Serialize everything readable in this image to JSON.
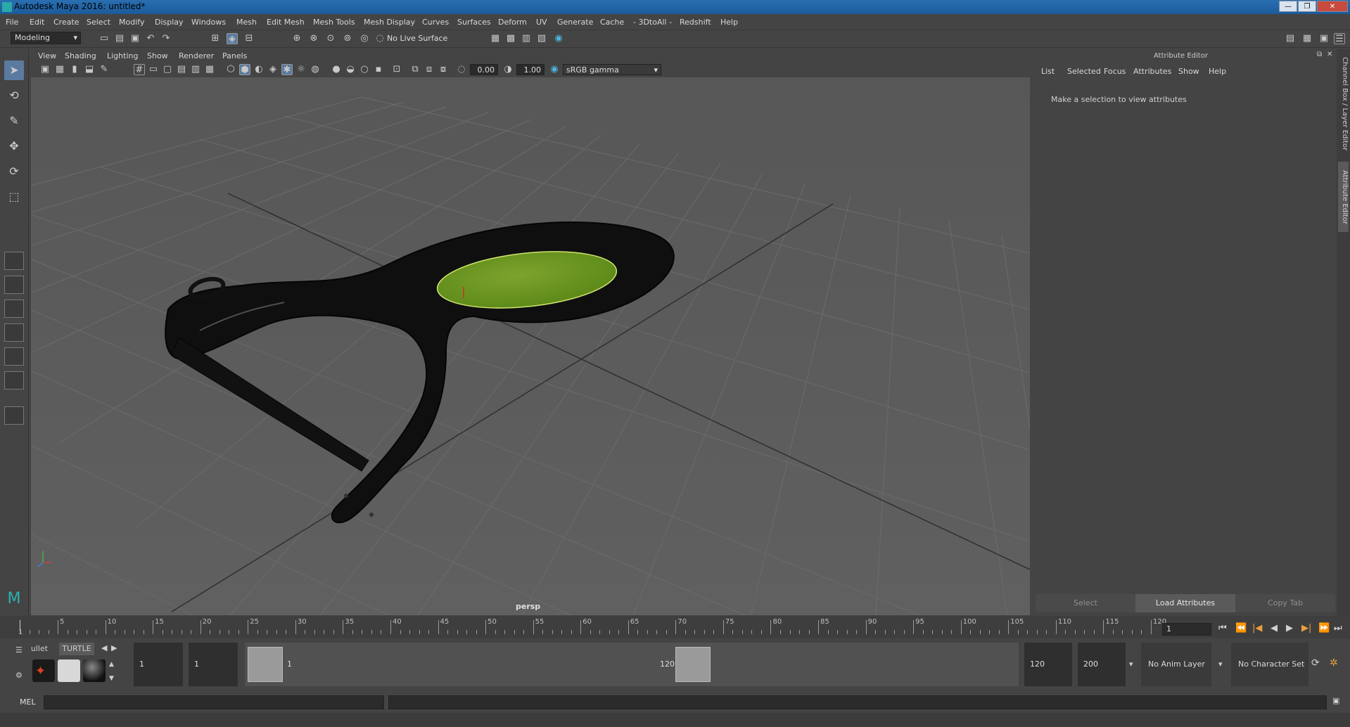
{
  "window": {
    "title": "Autodesk Maya 2016: untitled*"
  },
  "menu": [
    "File",
    "Edit",
    "Create",
    "Select",
    "Modify",
    "Display",
    "Windows",
    "Mesh",
    "Edit Mesh",
    "Mesh Tools",
    "Mesh Display",
    "Curves",
    "Surfaces",
    "Deform",
    "UV",
    "Generate",
    "Cache",
    "- 3DtoAll -",
    "Redshift",
    "Help"
  ],
  "status": {
    "mode": "Modeling",
    "live_surface": "No Live Surface"
  },
  "panel": {
    "menu": [
      "View",
      "Shading",
      "Lighting",
      "Show",
      "Renderer",
      "Panels"
    ],
    "exposure": "0.00",
    "gamma": "1.00",
    "colorspace": "sRGB gamma",
    "camera_label": "persp"
  },
  "attribute_editor": {
    "title": "Attribute Editor",
    "menu": [
      "List",
      "Selected",
      "Focus",
      "Attributes",
      "Show",
      "Help"
    ],
    "message": "Make a selection to view attributes",
    "buttons": {
      "select": "Select",
      "load": "Load Attributes",
      "copy": "Copy Tab"
    }
  },
  "side_tabs": {
    "channel_box": "Channel Box / Layer Editor",
    "attribute_editor": "Attribute Editor"
  },
  "timeline": {
    "ticks": [
      "5",
      "10",
      "15",
      "20",
      "25",
      "30",
      "35",
      "40",
      "45",
      "50",
      "55",
      "60",
      "65",
      "70",
      "75",
      "80",
      "85",
      "90",
      "95",
      "100",
      "105",
      "110",
      "115",
      "120"
    ],
    "start_label": "1",
    "current_frame": "1"
  },
  "range": {
    "shelf_tabs": {
      "bullet": "ullet",
      "turtle": "TURTLE"
    },
    "start": "1",
    "playback_start": "1",
    "handle_start": "1",
    "handle_end": "120",
    "playback_end": "120",
    "end": "200",
    "anim_layer": "No Anim Layer",
    "character_set": "No Character Set"
  },
  "command": {
    "label": "MEL"
  }
}
